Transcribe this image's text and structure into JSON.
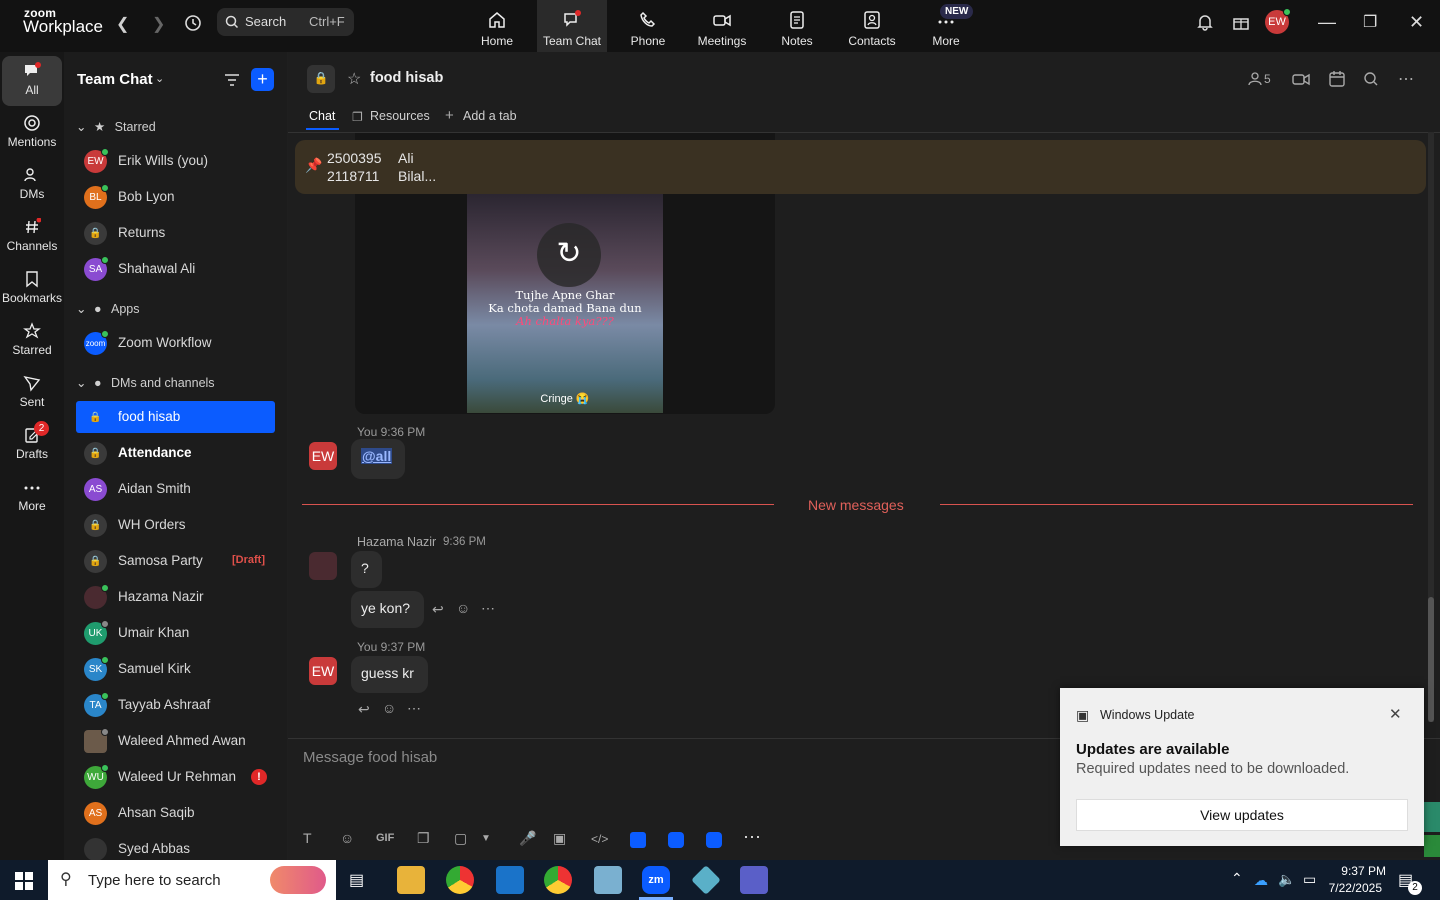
{
  "app": {
    "brand_small": "zoom",
    "brand_big": "Workplace"
  },
  "search": {
    "label": "Search",
    "shortcut": "Ctrl+F"
  },
  "topnav": [
    {
      "label": "Home"
    },
    {
      "label": "Team Chat"
    },
    {
      "label": "Phone"
    },
    {
      "label": "Meetings"
    },
    {
      "label": "Notes"
    },
    {
      "label": "Contacts"
    },
    {
      "label": "More",
      "badge": "NEW"
    }
  ],
  "user_initials": "EW",
  "rail": [
    {
      "label": "All"
    },
    {
      "label": "Mentions"
    },
    {
      "label": "DMs"
    },
    {
      "label": "Channels"
    },
    {
      "label": "Bookmarks"
    },
    {
      "label": "Starred"
    },
    {
      "label": "Sent"
    },
    {
      "label": "Drafts",
      "badge": "2"
    },
    {
      "label": "More"
    }
  ],
  "list": {
    "title": "Team Chat",
    "sections": {
      "starred": "Starred",
      "apps": "Apps",
      "dms": "DMs and channels"
    },
    "items": [
      {
        "initials": "EW",
        "name": "Erik Wills (you)",
        "color": "#c93a3a"
      },
      {
        "initials": "BL",
        "name": "Bob Lyon",
        "color": "#e0701c"
      },
      {
        "initials": "",
        "name": "Returns",
        "color": "#3a3a3a"
      },
      {
        "initials": "SA",
        "name": "Shahawal Ali",
        "color": "#8a4bd1"
      },
      {
        "initials": "zoom",
        "name": "Zoom Workflow",
        "color": "#0b5cff"
      },
      {
        "initials": "",
        "name": "food hisab",
        "color": "#0b5cff"
      },
      {
        "initials": "",
        "name": "Attendance",
        "color": "#3a3a3a"
      },
      {
        "initials": "AS",
        "name": "Aidan Smith",
        "color": "#8a4bd1"
      },
      {
        "initials": "",
        "name": "WH Orders",
        "color": "#3a3a3a"
      },
      {
        "initials": "",
        "name": "Samosa Party",
        "color": "#3a3a3a",
        "tag": "[Draft]"
      },
      {
        "initials": "",
        "name": "Hazama Nazir",
        "color": "#4a2a30"
      },
      {
        "initials": "UK",
        "name": "Umair Khan",
        "color": "#1f9c6e"
      },
      {
        "initials": "SK",
        "name": "Samuel Kirk",
        "color": "#2a86c9"
      },
      {
        "initials": "TA",
        "name": "Tayyab Ashraaf",
        "color": "#2a86c9"
      },
      {
        "initials": "",
        "name": "Waleed Ahmed Awan",
        "color": "#6b5a4a"
      },
      {
        "initials": "WU",
        "name": "Waleed Ur Rehman",
        "color": "#3ea83a"
      },
      {
        "initials": "AS",
        "name": "Ahsan Saqib",
        "color": "#e0701c"
      },
      {
        "initials": "",
        "name": "Syed Abbas",
        "color": "#333"
      }
    ]
  },
  "channel": {
    "name": "food hisab",
    "members": "5",
    "tabs": [
      "Chat",
      "Resources",
      "Add a tab"
    ],
    "pinned": {
      "line1_id": "2500395",
      "line1_name": "Ali",
      "line2_id": "2118711",
      "line2_name": "Bilal..."
    }
  },
  "media": {
    "caption1": "Tujhe Apne Ghar",
    "caption2": "Ka chota damad Bana dun",
    "caption3": "Ah chalta kya???",
    "caption4": "Cringe 😭"
  },
  "messages": {
    "m1_meta": "You 9:36 PM",
    "m1_text": "@all",
    "divider": "New messages",
    "m2_meta_name": "Hazama Nazir",
    "m2_meta_time": "9:36 PM",
    "m2_text1": "?",
    "m2_text2": "ye kon?",
    "m3_meta": "You 9:37 PM",
    "m3_text": "guess kr"
  },
  "composer": {
    "placeholder": "Message food hisab",
    "gif": "GIF"
  },
  "toast": {
    "app": "Windows Update",
    "title": "Updates are available",
    "body": "Required updates need to be downloaded.",
    "button": "View updates"
  },
  "taskbar": {
    "search": "Type here to search",
    "time": "9:37 PM",
    "date": "7/22/2025",
    "notif": "2"
  }
}
